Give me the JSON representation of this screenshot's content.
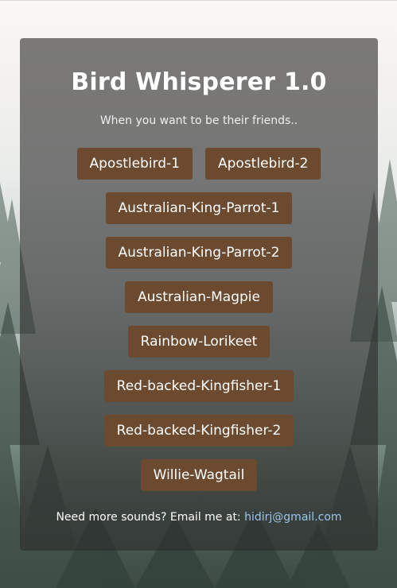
{
  "header": {
    "title": "Bird Whisperer 1.0",
    "subtitle": "When you want to be their friends.."
  },
  "buttons": [
    [
      "Apostlebird-1",
      "Apostlebird-2"
    ],
    [
      "Australian-King-Parrot-1"
    ],
    [
      "Australian-King-Parrot-2"
    ],
    [
      "Australian-Magpie"
    ],
    [
      "Rainbow-Lorikeet"
    ],
    [
      "Red-backed-Kingfisher-1"
    ],
    [
      "Red-backed-Kingfisher-2"
    ],
    [
      "Willie-Wagtail"
    ]
  ],
  "footer": {
    "text": "Need more sounds? Email me at: ",
    "email": "hidirj@gmail.com"
  },
  "colors": {
    "button_bg": "#6b4a2f",
    "link": "#9cc4ea",
    "card_overlay": "rgba(45,45,45,0.62)"
  },
  "icons": {
    "background": "forest-background-image"
  }
}
